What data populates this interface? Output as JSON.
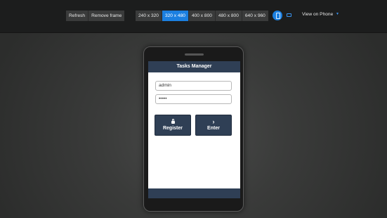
{
  "toolbar": {
    "refresh_label": "Refresh",
    "remove_frame_label": "Remove frame",
    "resolutions": [
      "240 x 320",
      "320 x 480",
      "400 x 800",
      "480 x 800",
      "640 x 960"
    ],
    "active_resolution": "320 x 480",
    "view_label": "View on Phone",
    "accent_color": "#1b7fe0"
  },
  "app": {
    "title": "Tasks Manager",
    "username_value": "admin",
    "password_value": "•••••",
    "register_label": "Register",
    "enter_label": "Enter",
    "header_color": "#2f3f55"
  },
  "icons": {
    "register": "lock-icon",
    "enter": "chevron-right-icon",
    "enter_glyph": "›"
  }
}
